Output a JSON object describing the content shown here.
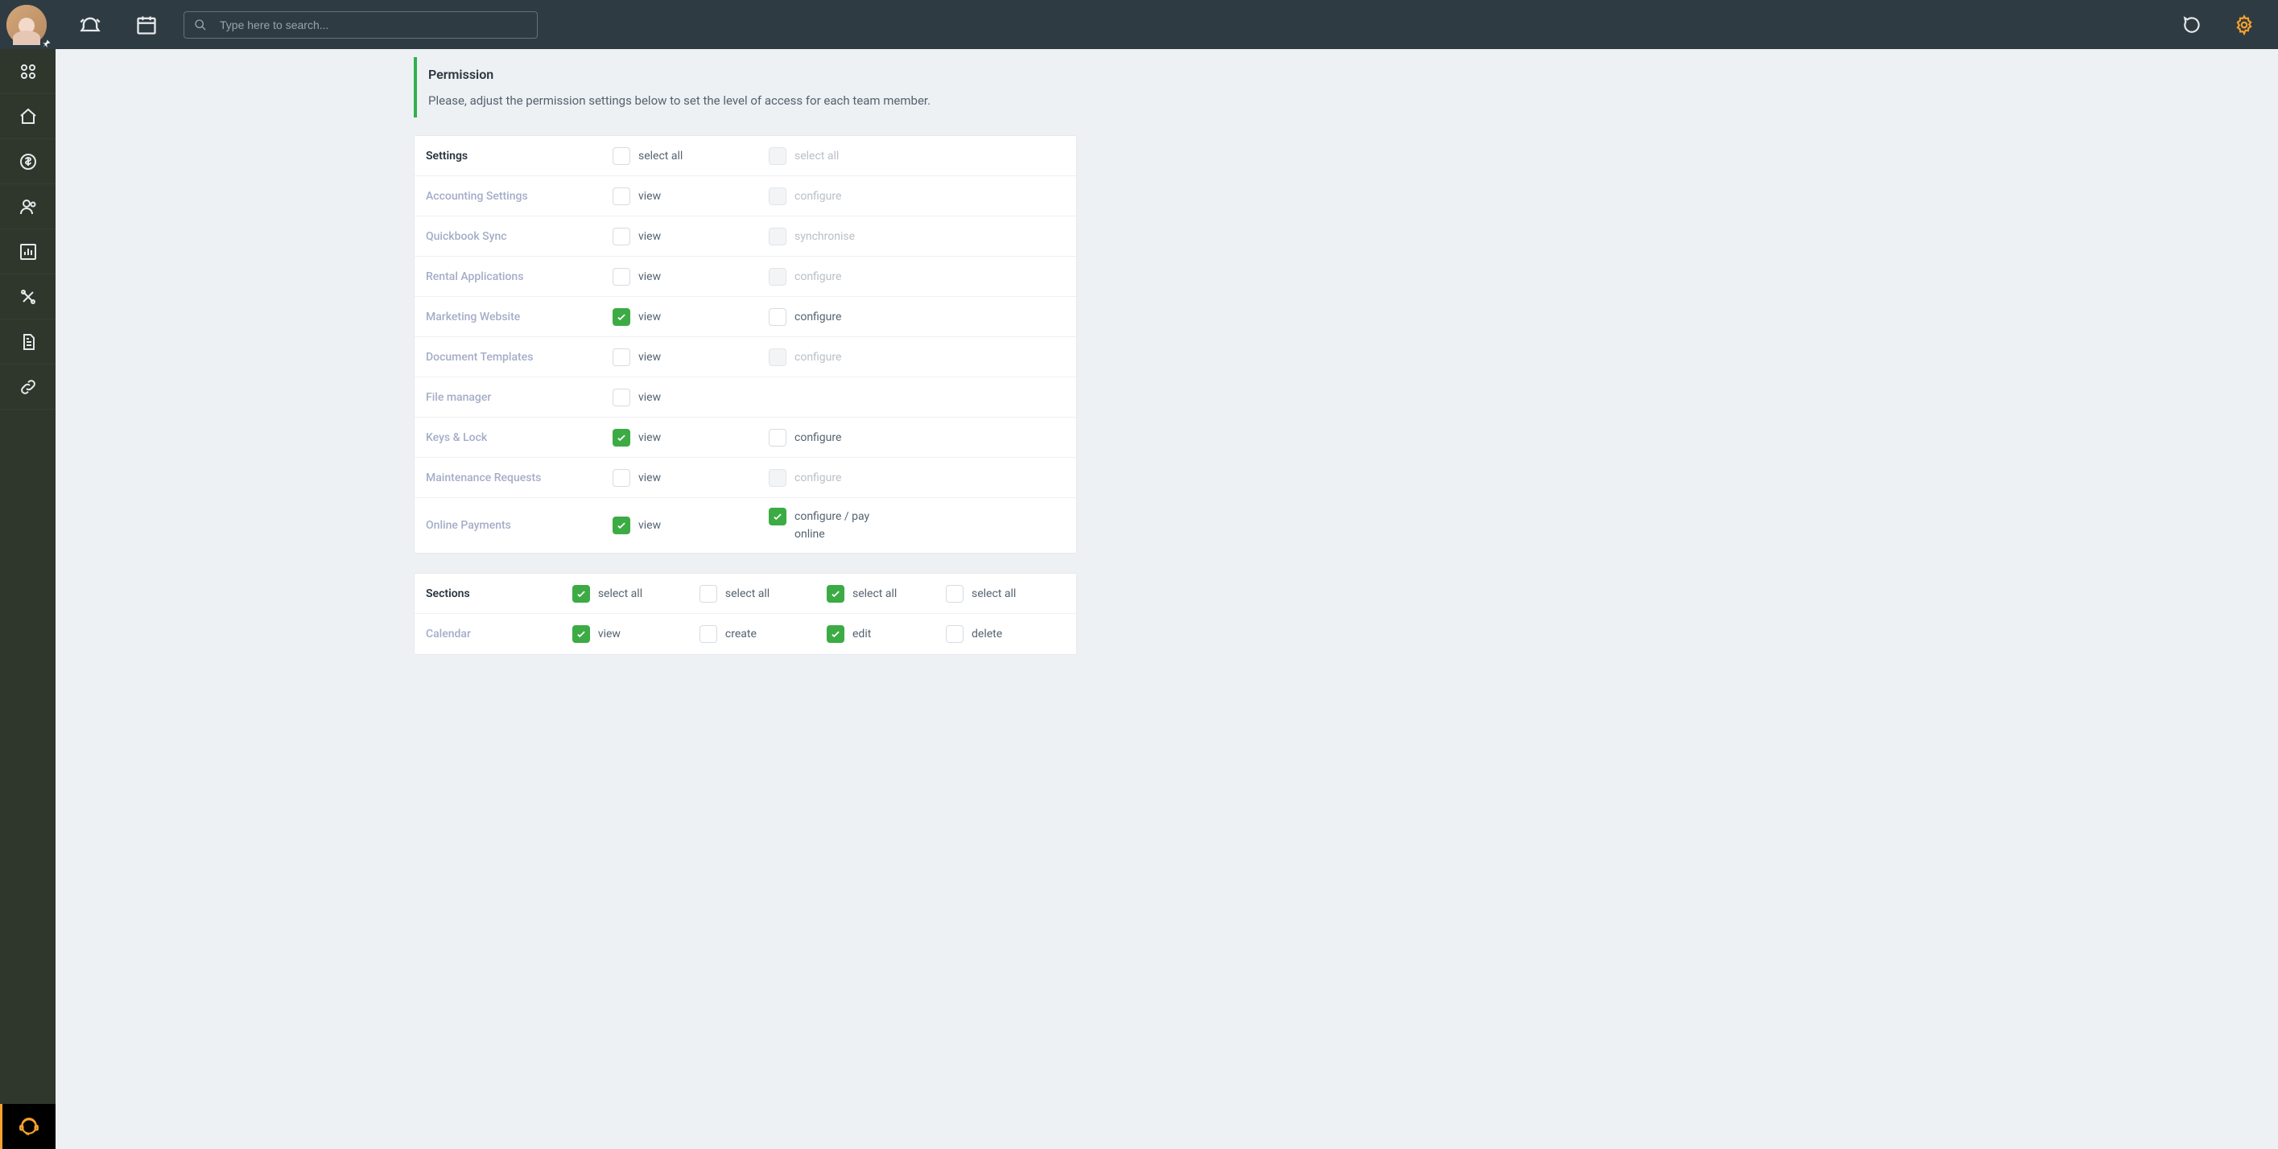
{
  "topbar": {
    "search_placeholder": "Type here to search..."
  },
  "permission": {
    "title": "Permission",
    "description": "Please, adjust the permission settings below to set the level of access for each team member."
  },
  "settings_panel": {
    "header": "Settings",
    "select_all_1": "select all",
    "select_all_2": "select all",
    "rows": [
      {
        "label": "Accounting Settings",
        "c1": {
          "text": "view",
          "checked": false,
          "disabled": false
        },
        "c2": {
          "text": "configure",
          "checked": false,
          "disabled": true
        }
      },
      {
        "label": "Quickbook Sync",
        "c1": {
          "text": "view",
          "checked": false,
          "disabled": false
        },
        "c2": {
          "text": "synchronise",
          "checked": false,
          "disabled": true
        }
      },
      {
        "label": "Rental Applications",
        "c1": {
          "text": "view",
          "checked": false,
          "disabled": false
        },
        "c2": {
          "text": "configure",
          "checked": false,
          "disabled": true
        }
      },
      {
        "label": "Marketing Website",
        "c1": {
          "text": "view",
          "checked": true,
          "disabled": false
        },
        "c2": {
          "text": "configure",
          "checked": false,
          "disabled": false
        }
      },
      {
        "label": "Document Templates",
        "c1": {
          "text": "view",
          "checked": false,
          "disabled": false
        },
        "c2": {
          "text": "configure",
          "checked": false,
          "disabled": true
        }
      },
      {
        "label": "File manager",
        "c1": {
          "text": "view",
          "checked": false,
          "disabled": false
        },
        "c2": null
      },
      {
        "label": "Keys & Lock",
        "c1": {
          "text": "view",
          "checked": true,
          "disabled": false
        },
        "c2": {
          "text": "configure",
          "checked": false,
          "disabled": false
        }
      },
      {
        "label": "Maintenance Requests",
        "c1": {
          "text": "view",
          "checked": false,
          "disabled": false
        },
        "c2": {
          "text": "configure",
          "checked": false,
          "disabled": true
        }
      },
      {
        "label": "Online Payments",
        "c1": {
          "text": "view",
          "checked": true,
          "disabled": false
        },
        "c2": {
          "text": "configure / pay online",
          "checked": true,
          "disabled": false
        }
      }
    ]
  },
  "sections_panel": {
    "header": "Sections",
    "select_all_1": "select all",
    "select_all_2": "select all",
    "select_all_3": "select all",
    "select_all_4": "select all",
    "rows": [
      {
        "label": "Calendar",
        "c1": {
          "text": "view",
          "checked": true
        },
        "c2": {
          "text": "create",
          "checked": false
        },
        "c3": {
          "text": "edit",
          "checked": true
        },
        "c4": {
          "text": "delete",
          "checked": false
        }
      }
    ]
  }
}
